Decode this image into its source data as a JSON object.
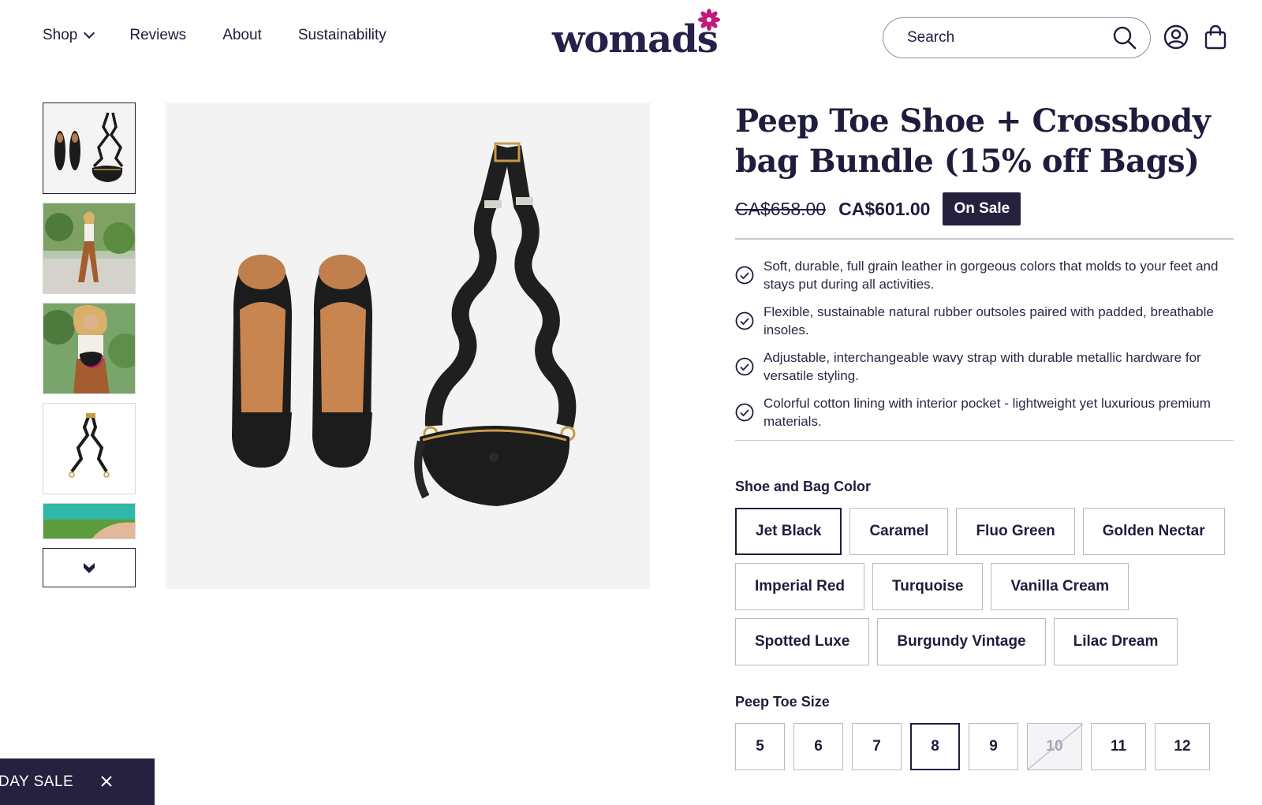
{
  "header": {
    "nav": [
      {
        "label": "Shop"
      },
      {
        "label": "Reviews"
      },
      {
        "label": "About"
      },
      {
        "label": "Sustainability"
      }
    ],
    "logo_text": "womads",
    "search_placeholder": "Search",
    "brand_color": "#25213f",
    "logo_accent": "#c2197a",
    "icons": [
      "search-icon",
      "account-icon",
      "cart-icon"
    ]
  },
  "gallery": {
    "thumbnails": [
      "shoes-and-bag",
      "model-walking",
      "model-holding-bag",
      "wavy-strap",
      "model-partial"
    ],
    "more_icon": "chevron-down-icon"
  },
  "product": {
    "title": "Peep Toe Shoe + Crossbody bag Bundle (15% off Bags)",
    "price_old": "CA$658.00",
    "price_new": "CA$601.00",
    "badge": "On Sale",
    "features": [
      {
        "text": "Soft, durable, full grain leather in gorgeous colors that molds to your feet and stays put during all activities."
      },
      {
        "text": "Flexible, sustainable natural rubber outsoles paired with padded, breathable insoles."
      },
      {
        "text": "Adjustable, interchangeable wavy strap with durable metallic hardware for versatile styling."
      },
      {
        "text": "Colorful cotton lining with interior pocket - lightweight yet luxurious premium materials."
      }
    ],
    "color_label": "Shoe and Bag Color",
    "colors": [
      {
        "label": "Jet Black"
      },
      {
        "label": "Caramel"
      },
      {
        "label": "Fluo Green"
      },
      {
        "label": "Golden Nectar"
      },
      {
        "label": "Imperial Red"
      },
      {
        "label": "Turquoise"
      },
      {
        "label": "Vanilla Cream"
      },
      {
        "label": "Spotted Luxe"
      },
      {
        "label": "Burgundy Vintage"
      },
      {
        "label": "Lilac Dream"
      }
    ],
    "selected_color": "Jet Black",
    "size_label": "Peep Toe Size",
    "sizes": [
      {
        "label": "5"
      },
      {
        "label": "6"
      },
      {
        "label": "7"
      },
      {
        "label": "8"
      },
      {
        "label": "9"
      },
      {
        "label": "10"
      },
      {
        "label": "11"
      },
      {
        "label": "12"
      }
    ],
    "selected_size": "8",
    "unavailable_size": "10"
  },
  "sale_banner": {
    "text": "DAY SALE"
  }
}
